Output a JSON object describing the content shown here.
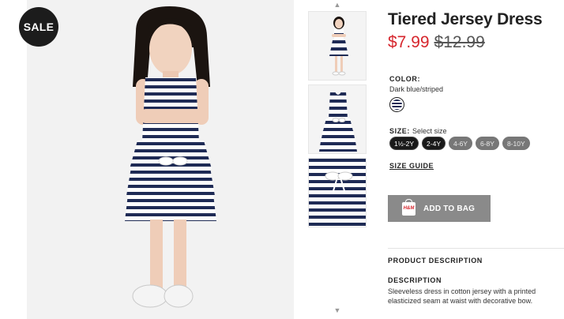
{
  "badge": {
    "sale": "SALE"
  },
  "thumbs": {
    "up_arrow": "▲",
    "down_arrow": "▼"
  },
  "product": {
    "title": "Tiered Jersey Dress",
    "price_sale": "$7.99",
    "price_original": "$12.99"
  },
  "color": {
    "label": "COLOR:",
    "value": "Dark blue/striped",
    "swatch_colors": [
      "#1f2b55",
      "#ffffff"
    ]
  },
  "size": {
    "label": "SIZE:",
    "hint": "Select size",
    "options": [
      {
        "label": "1½-2Y",
        "available": true
      },
      {
        "label": "2-4Y",
        "available": true
      },
      {
        "label": "4-6Y",
        "available": false
      },
      {
        "label": "6-8Y",
        "available": false
      },
      {
        "label": "8-10Y",
        "available": false
      }
    ],
    "guide": "SIZE GUIDE"
  },
  "cart": {
    "add_label": "ADD TO BAG",
    "icon_text": "H&M"
  },
  "description": {
    "section_heading": "PRODUCT DESCRIPTION",
    "heading": "DESCRIPTION",
    "text": "Sleeveless dress in cotton jersey with a printed elasticized seam at waist with decorative bow."
  },
  "colors": {
    "sale_red": "#d6262d",
    "button_grey": "#8a8a8a",
    "stripe_navy": "#1f2b55"
  }
}
